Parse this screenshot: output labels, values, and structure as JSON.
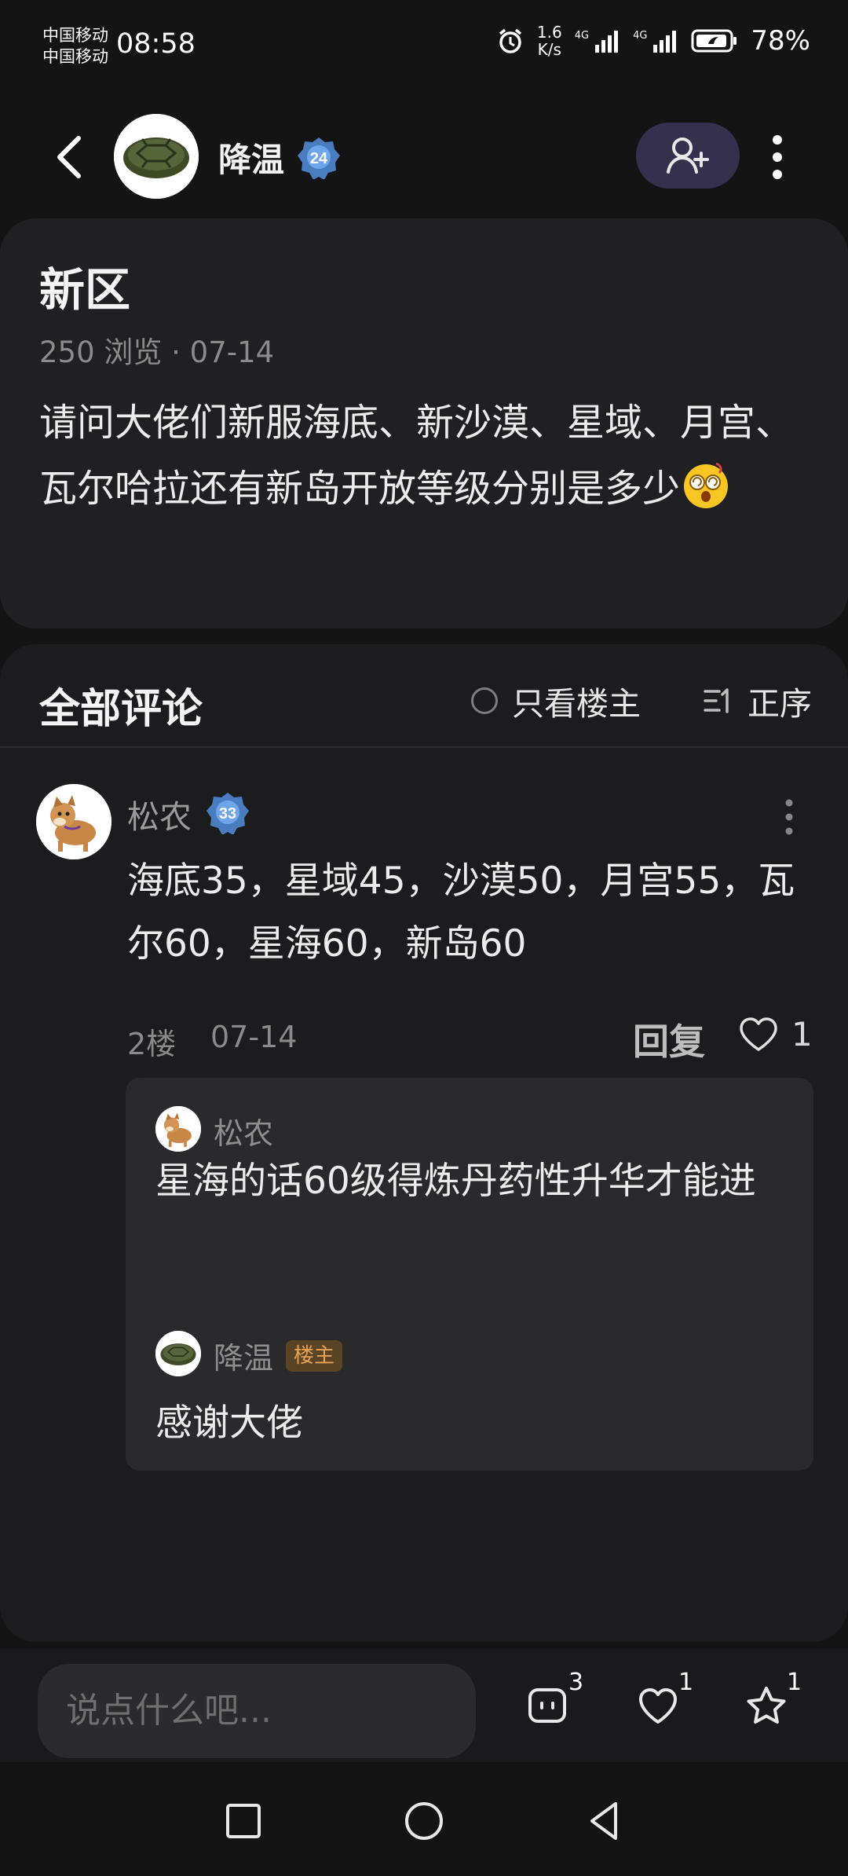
{
  "status_bar": {
    "carrier1": "中国移动",
    "carrier2": "中国移动",
    "time": "08:58",
    "speed_value": "1.6",
    "speed_unit": "K/s",
    "net1": "4G",
    "net2": "4G",
    "battery": "78%"
  },
  "header": {
    "username": "降温",
    "level": "24"
  },
  "post": {
    "title": "新区",
    "meta": "250 浏览 · 07-14",
    "body": "请问大佬们新服海底、新沙漠、星域、月宫、瓦尔哈拉还有新岛开放等级分别是多少"
  },
  "comments": {
    "title": "全部评论",
    "filter_op": "只看楼主",
    "sort": "正序",
    "items": [
      {
        "name": "松农",
        "level": "33",
        "text": "海底35，星域45，沙漠50，月宫55，瓦尔60，星海60，新岛60",
        "floor": "2楼",
        "date": "07-14",
        "reply_label": "回复",
        "likes": "1",
        "replies": [
          {
            "name": "松农",
            "text": "星海的话60级得炼丹药性升华才能进"
          },
          {
            "name": "降温",
            "badge": "楼主",
            "text": "感谢大佬"
          }
        ]
      }
    ]
  },
  "bottom_bar": {
    "input_placeholder": "说点什么吧...",
    "comment_count": "3",
    "like_count": "1",
    "star_count": "1"
  },
  "colors": {
    "background": "#141414",
    "card": "#202022",
    "follow_button": "#35304e",
    "op_badge_text": "#e8a253",
    "level_badge": "#5b8fd6"
  },
  "icons": [
    "back-icon",
    "add-user-icon",
    "more-vertical-icon",
    "comment-icon",
    "heart-icon",
    "star-icon",
    "sort-icon"
  ]
}
